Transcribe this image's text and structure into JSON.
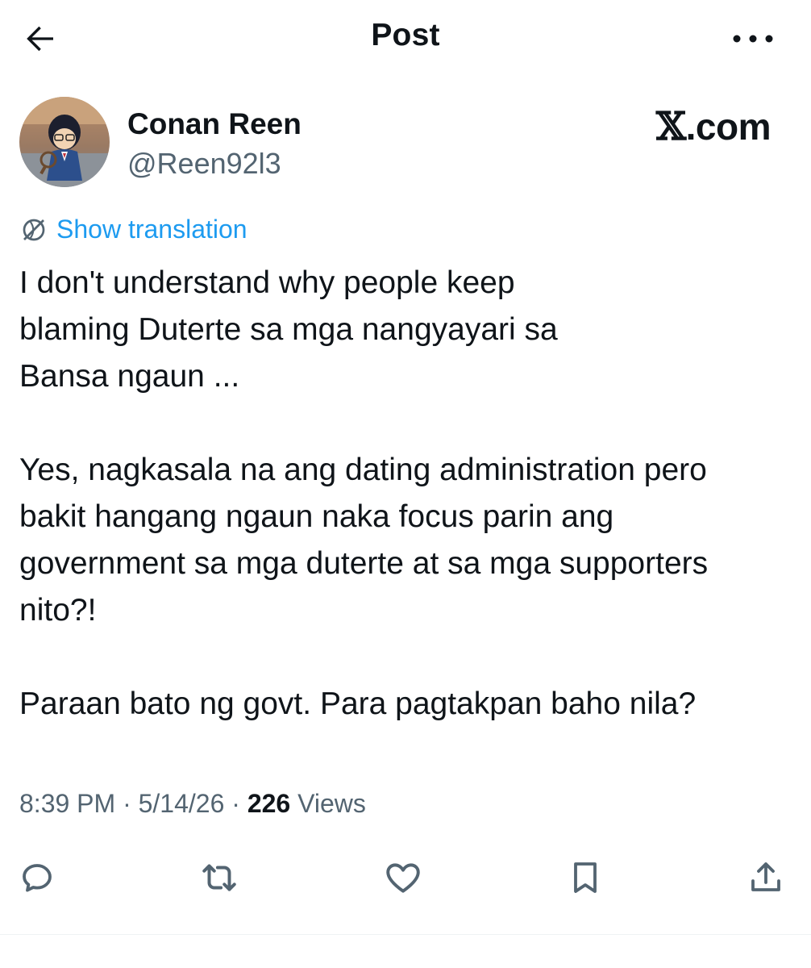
{
  "header": {
    "title": "Post",
    "back_icon": "arrow-left-icon",
    "more_icon": "more-horizontal-icon"
  },
  "author": {
    "name": "Conan Reen",
    "handle": "@Reen92l3"
  },
  "site": {
    "logo_mark": "𝕏",
    "logo_text": ".com"
  },
  "translation": {
    "label": "Show translation",
    "icon": "globe-icon"
  },
  "post": {
    "paragraphs": [
      [
        "I don't understand why people keep",
        "blaming Duterte sa mga nangyayari sa",
        "Bansa ngaun ..."
      ],
      [
        "Yes, nagkasala na ang dating administration pero",
        "bakit hangang ngaun naka focus parin ang",
        "government sa mga duterte at sa mga supporters",
        "nito?!"
      ],
      [
        "Paraan bato ng govt. Para pagtakpan baho nila?"
      ]
    ]
  },
  "meta": {
    "time": "8:39 PM",
    "separator": "·",
    "date": "5/14/26",
    "views_count": "226",
    "views_label": "Views"
  },
  "actions": [
    {
      "name": "reply",
      "icon": "reply-icon"
    },
    {
      "name": "repost",
      "icon": "repost-icon"
    },
    {
      "name": "like",
      "icon": "heart-icon"
    },
    {
      "name": "bookmark",
      "icon": "bookmark-icon"
    },
    {
      "name": "share",
      "icon": "share-icon"
    }
  ],
  "colors": {
    "text": "#0f1419",
    "secondary": "#536471",
    "link": "#1d9bf0",
    "background": "#ffffff"
  }
}
